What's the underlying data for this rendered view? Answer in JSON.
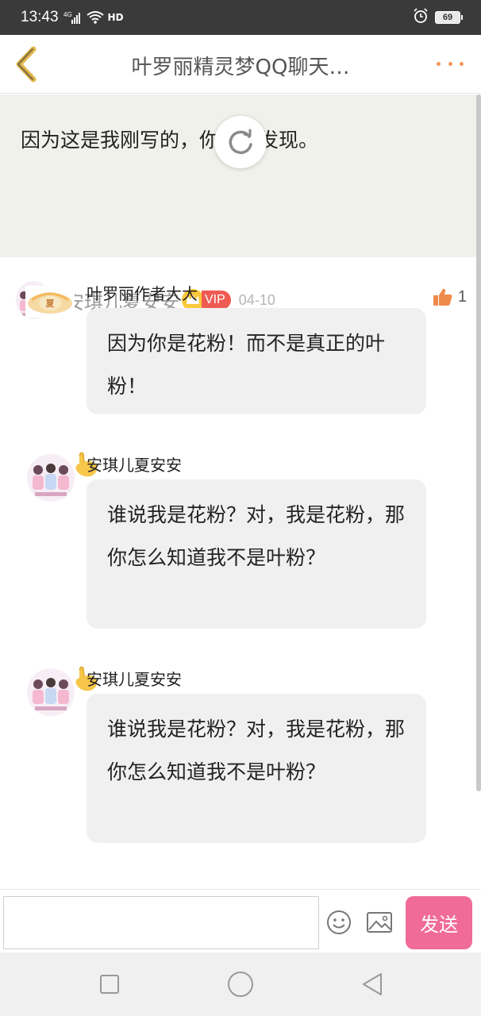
{
  "status_bar": {
    "time": "13:43",
    "network": "4G",
    "wifi_label": "HD",
    "battery": "69"
  },
  "header": {
    "title": "叶罗丽精灵梦QQ聊天…",
    "back_icon": "chevron-left-icon",
    "more_icon": "more-dots-icon",
    "accent_color": "#f2975c"
  },
  "post": {
    "text": "因为这是我刚写的，你没有发现。",
    "user": "安琪儿夏安安",
    "vip_label": "VIP",
    "date": "04-10",
    "likes": "1"
  },
  "messages": [
    {
      "name": "叶罗丽作者大大",
      "text": "因为你是花粉！而不是真正的叶粉！"
    },
    {
      "name": "安琪儿夏安安",
      "text": "谁说我是花粉？对，我是花粉，那你怎么知道我不是叶粉？"
    },
    {
      "name": "安琪儿夏安安",
      "text": "谁说我是花粉？对，我是花粉，那你怎么知道我不是叶粉？"
    }
  ],
  "input": {
    "placeholder": "",
    "send_label": "发送",
    "send_color": "#f06b98"
  },
  "nav": {
    "icons": [
      "recent-apps-icon",
      "home-icon",
      "back-icon"
    ]
  }
}
